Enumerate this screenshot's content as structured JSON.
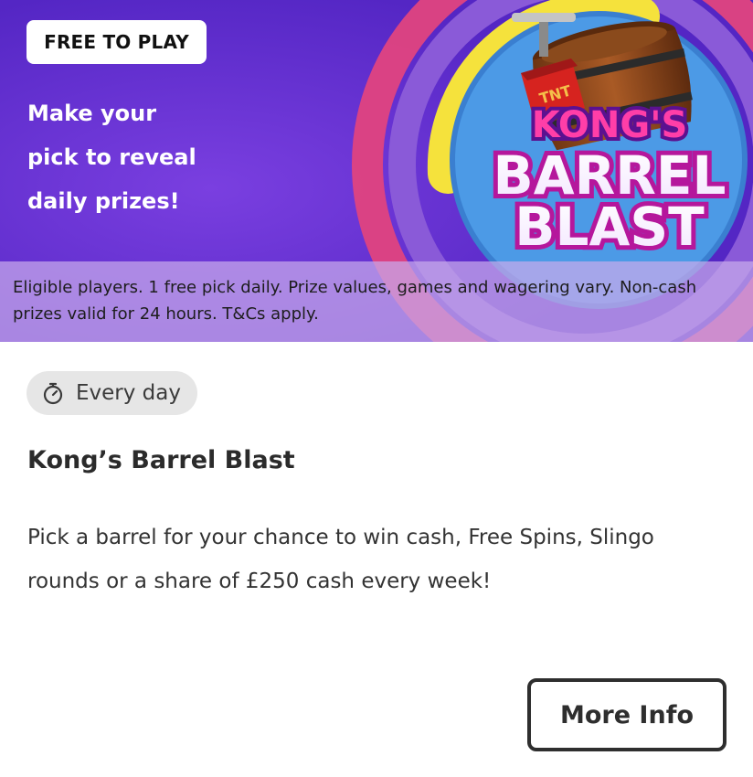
{
  "banner": {
    "badge": "FREE TO PLAY",
    "headline": [
      "Make your",
      "pick to reveal",
      "daily prizes!"
    ],
    "logo": {
      "line1": "KONG'S",
      "line2": "BARREL",
      "line3": "BLAST",
      "tnt_label": "TNT"
    },
    "terms": "Eligible players. 1 free pick daily. Prize values, games and wagering vary. Non-cash prizes valid for 24 hours. T&Cs apply."
  },
  "schedule": {
    "icon": "stopwatch-icon",
    "label": "Every day"
  },
  "promo": {
    "title": "Kong’s Barrel Blast",
    "description": "Pick a barrel for your chance to win cash, Free Spins, Slingo rounds or a share of £250 cash every week!"
  },
  "actions": {
    "more_info": "More Info"
  },
  "colors": {
    "banner_bg": "#5a2bc9",
    "ring_pink": "#e0437f",
    "ring_yellow": "#f5e23c",
    "ring_blue": "#3f8fe0",
    "terms_bg": "#c8aaec",
    "chip_bg": "#e6e6e6",
    "button_border": "#2e2e2e"
  }
}
